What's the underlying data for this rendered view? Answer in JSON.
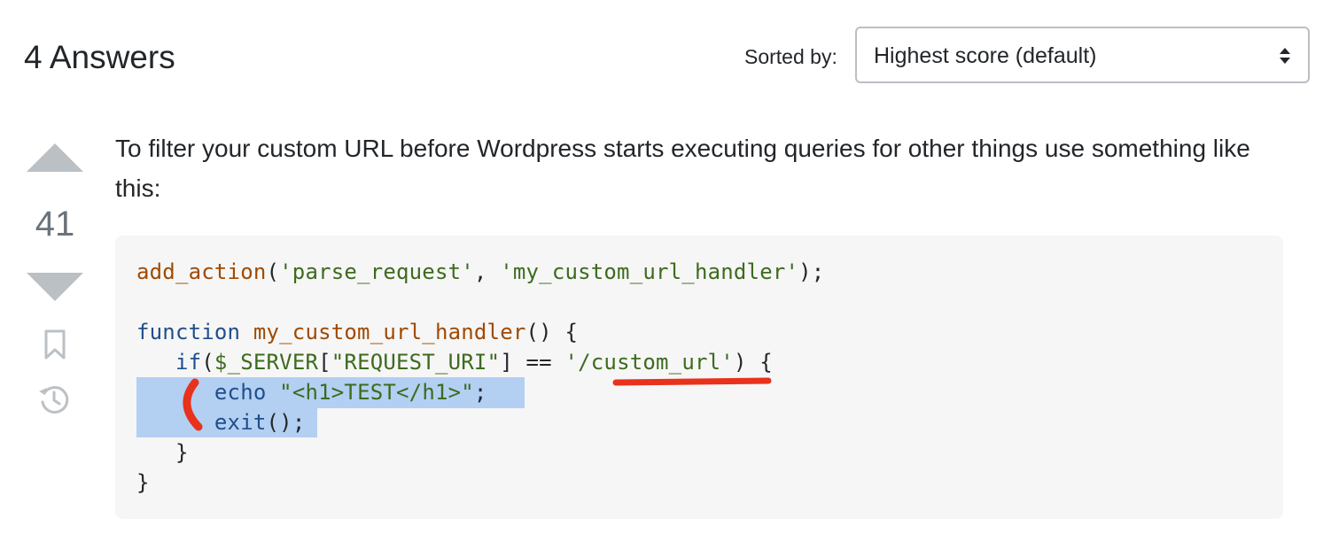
{
  "header": {
    "answers_count_title": "4 Answers",
    "sort_label": "Sorted by:",
    "sort_value": "Highest score (default)"
  },
  "vote": {
    "score": "41",
    "up_icon": "arrow-up-icon",
    "down_icon": "arrow-down-icon",
    "bookmark_icon": "bookmark-icon",
    "history_icon": "history-icon"
  },
  "answer": {
    "body_text": "To filter your custom URL before Wordpress starts executing queries for other things use something like this:"
  },
  "code": {
    "line1": {
      "fn": "add_action",
      "p1": "(",
      "s1": "'parse_request'",
      "p2": ", ",
      "s2": "'my_custom_url_handler'",
      "p3": ");"
    },
    "line2": {
      "kw": "function",
      "sp": " ",
      "fn": "my_custom_url_handler",
      "p": "() {"
    },
    "line3": {
      "indent": "   ",
      "kw": "if",
      "p1": "(",
      "var": "$_SERVER",
      "p2": "[",
      "s1": "\"REQUEST_URI\"",
      "p3": "] == ",
      "s2": "'/custom_url'",
      "p4": ") {"
    },
    "line4": {
      "indent": "      ",
      "kw": "echo",
      "sp": " ",
      "s": "\"<h1>TEST</h1>\"",
      "p": ";"
    },
    "line5": {
      "indent": "      ",
      "kw": "exit",
      "p": "();"
    },
    "line6": {
      "text": "   }"
    },
    "line7": {
      "text": "}"
    }
  },
  "colors": {
    "function_name": "#a04a00",
    "string": "#3d6b1e",
    "keyword": "#1f4f8a",
    "selection": "#b3cff2",
    "annotation_red": "#e8321c",
    "vote_gray": "#bbc0c4"
  }
}
